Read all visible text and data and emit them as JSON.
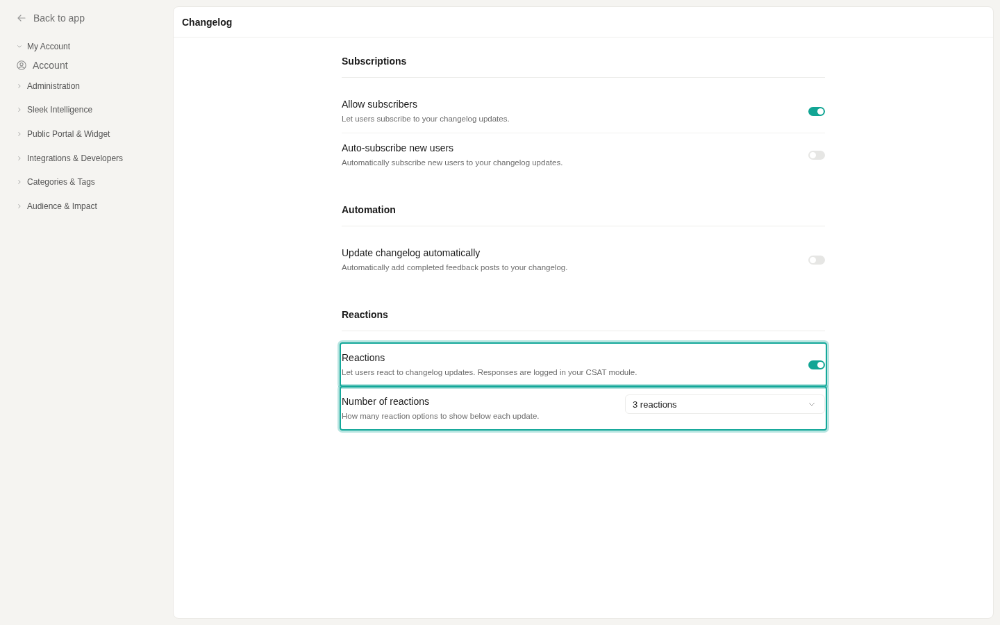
{
  "sidebar": {
    "back_link": {
      "label": "Back to app"
    },
    "groups": [
      {
        "label": "My Account",
        "expanded": true,
        "children": [
          {
            "label": "Account"
          }
        ]
      },
      {
        "label": "Administration",
        "expanded": false
      },
      {
        "label": "Sleek Intelligence",
        "expanded": false
      },
      {
        "label": "Public Portal & Widget",
        "expanded": false
      },
      {
        "label": "Integrations & Developers",
        "expanded": false
      },
      {
        "label": "Categories & Tags",
        "expanded": false
      },
      {
        "label": "Audience & Impact",
        "expanded": false
      }
    ]
  },
  "panel": {
    "title": "Changelog"
  },
  "sections": [
    {
      "title": "Subscriptions",
      "settings": [
        {
          "kind": "toggle",
          "title": "Allow subscribers",
          "description": "Let users subscribe to your changelog updates.",
          "on": true,
          "highlighted": false
        },
        {
          "kind": "toggle",
          "title": "Auto-subscribe new users",
          "description": "Automatically subscribe new users to your changelog updates.",
          "on": false,
          "highlighted": false
        }
      ]
    },
    {
      "title": "Automation",
      "settings": [
        {
          "kind": "toggle",
          "title": "Update changelog automatically",
          "description": "Automatically add completed feedback posts to your changelog.",
          "on": false,
          "highlighted": false
        }
      ]
    },
    {
      "title": "Reactions",
      "settings": [
        {
          "kind": "toggle",
          "title": "Reactions",
          "description": "Let users react to changelog updates. Responses are logged in your CSAT module.",
          "on": true,
          "highlighted": true
        },
        {
          "kind": "select",
          "title": "Number of reactions",
          "description": "How many reaction options to show below each update.",
          "value": "3 reactions",
          "highlighted": true
        }
      ]
    }
  ]
}
